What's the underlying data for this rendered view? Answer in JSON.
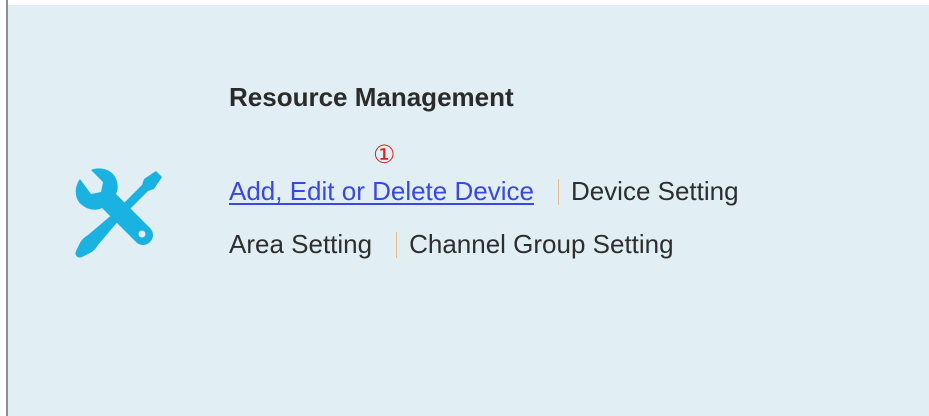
{
  "panel": {
    "title": "Resource Management",
    "icon": "wrench-screwdriver-icon",
    "accent_color": "#1ab2e0",
    "step_marker": "①",
    "marker_color": "#e02020",
    "links": [
      {
        "label": "Add, Edit or Delete Device",
        "state": "active"
      },
      {
        "label": "Device Setting",
        "state": "normal"
      },
      {
        "label": "Area Setting",
        "state": "normal"
      },
      {
        "label": "Channel Group Setting",
        "state": "normal"
      }
    ]
  }
}
